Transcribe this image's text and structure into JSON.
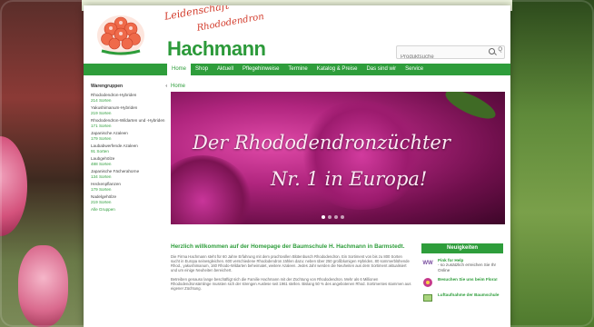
{
  "header": {
    "tagline_line1": "Leidenschaft",
    "tagline_line2": "Rhododendron",
    "brand": "Hachmann",
    "search_placeholder": "Produktsuche",
    "search_option": "Q"
  },
  "nav": {
    "items": [
      "Home",
      "Shop",
      "Aktuell",
      "Pflegehinweise",
      "Termine",
      "Katalog & Preise",
      "Das sind wir",
      "Service"
    ]
  },
  "sidebar": {
    "title": "Warengruppen",
    "toggle": "‹",
    "items": [
      {
        "title": "Rhododendron-Hybriden",
        "count": "214 Sorten"
      },
      {
        "title": "Yakushimanum-Hybriden",
        "count": "219 Sorten"
      },
      {
        "title": "Rhododendron-Wildarten und -Hybriden",
        "count": "171 Sorten"
      },
      {
        "title": "Japanische Azaleen",
        "count": "179 Sorten"
      },
      {
        "title": "Laubabwerfende Azaleen",
        "count": "91 Sorten"
      },
      {
        "title": "Laubgehölze",
        "count": "488 Sorten"
      },
      {
        "title": "Japanische Fächerahorne",
        "count": "134 Sorten"
      },
      {
        "title": "Heckenpflanzen",
        "count": "179 Sorten"
      },
      {
        "title": "Nadelgehölze",
        "count": "219 Sorten"
      }
    ],
    "more": "Alle Gruppen"
  },
  "main": {
    "breadcrumb": "Home",
    "hero_line1": "Der Rhododendronzüchter",
    "hero_line2": "Nr. 1 in Europa!",
    "slides": 4,
    "active_slide": 1
  },
  "welcome": {
    "heading": "Herzlich willkommen auf der Homepage der Baumschule H. Hachmann in Barmstedt.",
    "paragraph1": "Die Firma Hachmann steht für 60 Jahre Erfahrung mit dem prachtvollen Blütenbusch Rhododendron. Ein Sortiment von bis zu 800 Sorten sucht in Europa seinesgleichen. 600 verschiedene Rhododendron zählen dazu: neben über 250 großblumigen Hybriden, 80 sommerblühende Rhod., yakushimanum, 160 Rhodo-Wildarten beheimatet, weitere Azaleen. Jedes Jahr werden die Neuheiten aus dem Sortiment aktualisiert und um einige Neuheiten bereichert.",
    "paragraph2": "Betreiben genauso lange beschäftigt sich die Familie Hachmann mit der Züchtung von Rhododendron. Mehr als 6 Millionen Rhododendronsämlinge mussten sich der strengen Auslese seit 1961 stellen. Bislang 50 % des angebotenen Rhod. Sortimentes stammen aus eigener Züchtung."
  },
  "news": {
    "title": "Neuigkeiten",
    "items": [
      {
        "icon": "www-icon",
        "title": "Pink for Help",
        "text": "- so zusätzlich erreichen Sie Ihr Online"
      },
      {
        "icon": "flower-icon",
        "title": "Besuchen Sie uns beim Flora!",
        "text": ""
      },
      {
        "icon": "book-icon",
        "title": "Luftaufnahme der Baumschule",
        "text": ""
      }
    ]
  },
  "colors": {
    "brand_green": "#2e9d3b",
    "tagline_red": "#d23a2a",
    "hero_magenta": "#b0257e"
  }
}
